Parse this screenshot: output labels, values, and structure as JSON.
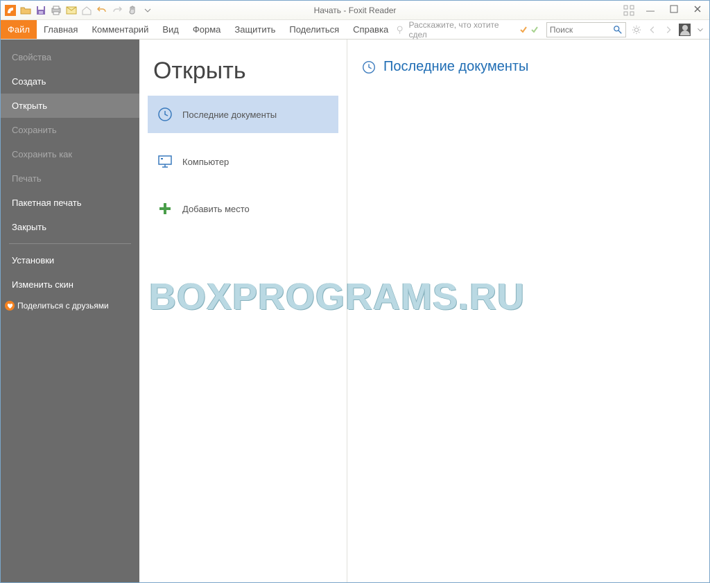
{
  "window_title": "Начать - Foxit Reader",
  "ribbon_tabs": {
    "file": "Файл",
    "home": "Главная",
    "comment": "Комментарий",
    "view": "Вид",
    "form": "Форма",
    "protect": "Защитить",
    "share": "Поделиться",
    "help": "Справка"
  },
  "tellme_placeholder": "Расскажите, что хотите сдел",
  "search_placeholder": "Поиск",
  "sidebar": {
    "items": [
      {
        "id": "properties",
        "label": "Свойства",
        "state": "disabled"
      },
      {
        "id": "create",
        "label": "Создать",
        "state": "enabled"
      },
      {
        "id": "open",
        "label": "Открыть",
        "state": "selected"
      },
      {
        "id": "save",
        "label": "Сохранить",
        "state": "disabled"
      },
      {
        "id": "saveas",
        "label": "Сохранить как",
        "state": "disabled"
      },
      {
        "id": "print",
        "label": "Печать",
        "state": "disabled"
      },
      {
        "id": "batchprint",
        "label": "Пакетная печать",
        "state": "enabled"
      },
      {
        "id": "close",
        "label": "Закрыть",
        "state": "enabled"
      },
      {
        "id": "divider",
        "label": "",
        "state": "divider"
      },
      {
        "id": "installs",
        "label": "Установки",
        "state": "enabled"
      },
      {
        "id": "skin",
        "label": "Изменить скин",
        "state": "enabled"
      }
    ],
    "share": "Поделиться с друзьями"
  },
  "open_page": {
    "title": "Открыть",
    "sources": {
      "recent": "Последние документы",
      "computer": "Компьютер",
      "addplace": "Добавить место"
    },
    "panel_title": "Последние документы"
  },
  "watermark": "BOXPROGRAMS.RU"
}
